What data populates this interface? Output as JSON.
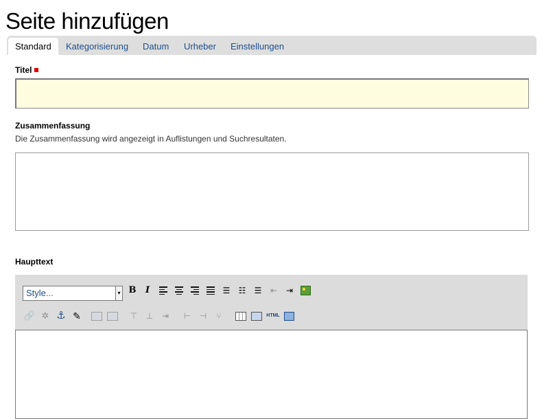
{
  "page": {
    "title": "Seite hinzufügen"
  },
  "tabs": [
    {
      "label": "Standard",
      "active": true
    },
    {
      "label": "Kategorisierung",
      "active": false
    },
    {
      "label": "Datum",
      "active": false
    },
    {
      "label": "Urheber",
      "active": false
    },
    {
      "label": "Einstellungen",
      "active": false
    }
  ],
  "fields": {
    "title": {
      "label": "Titel",
      "required": true,
      "value": ""
    },
    "summary": {
      "label": "Zusammenfassung",
      "help": "Die Zusammenfassung wird angezeigt in Auflistungen und Suchresultaten.",
      "value": ""
    },
    "body": {
      "label": "Haupttext",
      "value": ""
    }
  },
  "editor": {
    "style_select": "Style...",
    "html_label": "HTML",
    "bold_label": "B",
    "italic_label": "I"
  },
  "colors": {
    "tab_bar": "#dedede",
    "link": "#1f4e8c",
    "title_input_bg": "#fffde0",
    "required_marker": "#e00000",
    "toolbar_bg": "#dcdcdc"
  }
}
